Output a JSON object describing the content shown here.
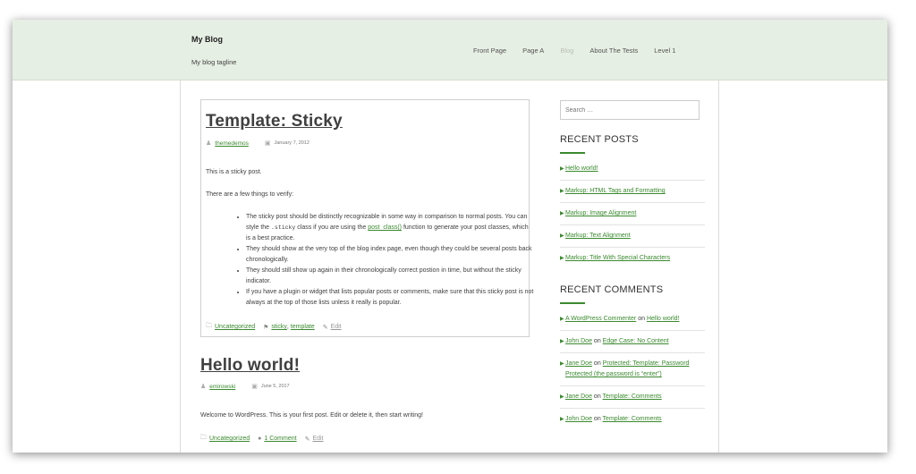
{
  "header": {
    "site_title": "My Blog",
    "tagline": "My blog tagline",
    "nav": [
      "Front Page",
      "Page A",
      "Blog",
      "About The Tests",
      "Level 1"
    ]
  },
  "posts": {
    "sticky": {
      "title": "Template: Sticky",
      "author": "themedemos",
      "date": "January 7, 2012",
      "intro": "This is a sticky post.",
      "verify_heading": "There are a few things to verify:",
      "bullet1_pre": "The sticky post should be distinctly recognizable in some way in comparison to normal posts. You can style the ",
      "bullet1_code": ".sticky",
      "bullet1_mid": " class if you are using the ",
      "bullet1_link": "post_class()",
      "bullet1_post": " function to generate your post classes, which is a best practice.",
      "bullet2": "They should show at the very top of the blog index page, even though they could be several posts back chronologically.",
      "bullet3": "They should still show up again in their chronologically correct postion in time, but without the sticky indicator.",
      "bullet4": "If you have a plugin or widget that lists popular posts or comments, make sure that this sticky post is not always at the top of those lists unless it really is popular.",
      "category": "Uncategorized",
      "tag1": "sticky",
      "tag_sep": ",",
      "tag2": "template",
      "edit": "Edit"
    },
    "hello": {
      "title": "Hello world!",
      "author": "emirowski",
      "date": "June 5, 2017",
      "body": "Welcome to WordPress. This is your first post. Edit or delete it, then start writing!",
      "category": "Uncategorized",
      "comments": "1 Comment",
      "edit": "Edit"
    }
  },
  "sidebar": {
    "search_placeholder": "Search …",
    "recent_posts_title": "RECENT POSTS",
    "recent_posts": [
      "Hello world!",
      "Markup: HTML Tags and Formatting",
      "Markup: Image Alignment",
      "Markup: Text Alignment",
      "Markup: Title With Special Characters"
    ],
    "recent_comments_title": "RECENT COMMENTS",
    "on_word": "on",
    "recent_comments": [
      {
        "author": "A WordPress Commenter",
        "post": "Hello world!"
      },
      {
        "author": "John Doe",
        "post": "Edge Case: No Content"
      },
      {
        "author": "Jane Doe",
        "post": "Protected: Template: Password Protected (the password is “enter”)"
      },
      {
        "author": "Jane Doe",
        "post": "Template: Comments"
      },
      {
        "author": "John Doe",
        "post": "Template: Comments"
      }
    ]
  },
  "colors": {
    "header_bg": "#e6efe3",
    "link": "#3a8a2e",
    "nav_current": "#b9beb8"
  },
  "icons": {
    "author": "user-icon",
    "date": "calendar-icon",
    "category": "folder-icon",
    "tags": "tag-icon",
    "edit": "pencil-icon",
    "comments": "comment-icon",
    "list_bullet": "triangle-right-icon"
  }
}
